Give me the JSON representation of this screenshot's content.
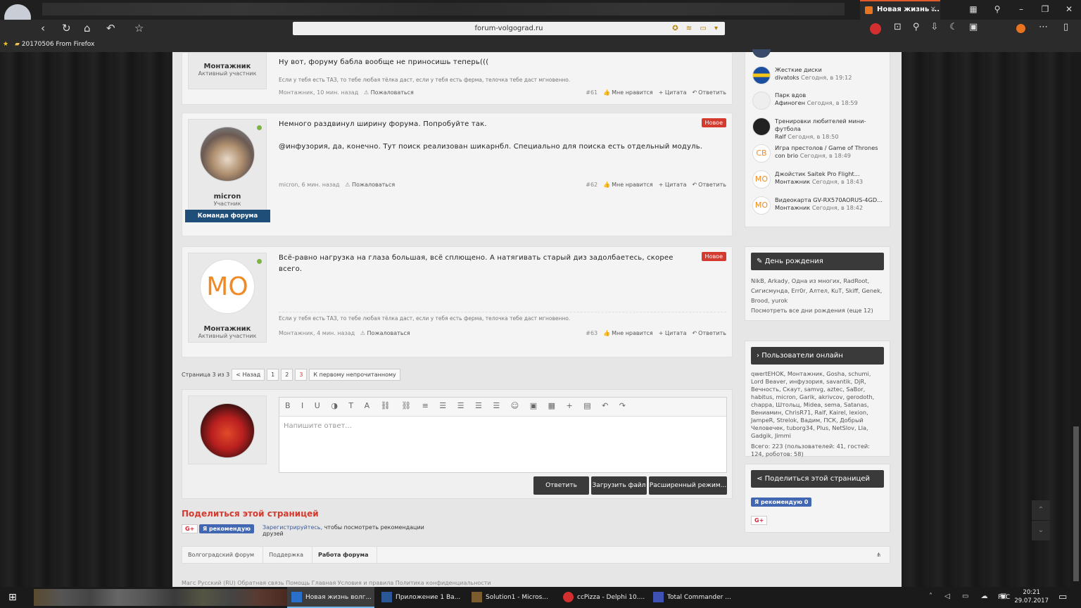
{
  "browser": {
    "active_tab_title": "Новая жизнь ...",
    "url": "forum-volgograd.ru",
    "bookmark": "20170506 From Firefox",
    "nav_icons": [
      "back-icon",
      "reload-icon",
      "home-icon",
      "undo-icon",
      "star-icon"
    ]
  },
  "posts": [
    {
      "user": "Монтажник",
      "role": "Активный участник",
      "text": "Ну вот, форуму бабла вообще не приносишь теперь(((",
      "signature": "Если у тебя есть ТАЗ, то тебе любая тёлка даст, если у тебя есть ферма, телочка тебе даст мгновенно.",
      "meta_left": "Монтажник, 10 мин. назад",
      "report": "Пожаловаться",
      "number": "#61",
      "like": "Мне нравится",
      "quote": "+ Цитата",
      "reply": "Ответить"
    },
    {
      "user": "micron",
      "role": "Участник",
      "team_badge": "Команда форума",
      "new_badge": "Новое",
      "text1": "Немного раздвинул ширину форума. Попробуйте так.",
      "text2": "@инфузория, да, конечно. Тут поиск реализован шикарнбл. Специально для поиска есть отдельный модуль.",
      "meta_left": "micron, 6 мин. назад",
      "report": "Пожаловаться",
      "number": "#62",
      "like": "Мне нравится",
      "quote": "+ Цитата",
      "reply": "Ответить"
    },
    {
      "user": "Монтажник",
      "role": "Активный участник",
      "avatar_text": "МО",
      "new_badge": "Новое",
      "text": "Всё-равно нагрузка на глаза большая, всё сплющено. А натягивать старый диз задолбаетесь, скорее всего.",
      "signature": "Если у тебя есть ТАЗ, то тебе любая тёлка даст, если у тебя есть ферма, телочка тебе даст мгновенно.",
      "meta_left": "Монтажник, 4 мин. назад",
      "report": "Пожаловаться",
      "number": "#63",
      "like": "Мне нравится",
      "quote": "+ Цитата",
      "reply": "Ответить"
    }
  ],
  "pager": {
    "label": "Страница 3 из 3",
    "prev": "< Назад",
    "pages": [
      "1",
      "2",
      "3"
    ],
    "first_unread": "К первому непрочитанному"
  },
  "editor": {
    "placeholder": "Напишите ответ...",
    "reply": "Ответить",
    "upload": "Загрузить файл",
    "advanced": "Расширенный режим..."
  },
  "share": {
    "title": "Поделиться этой страницей",
    "gplus": "G+",
    "fb": "Я рекомендую",
    "register": "Зарегистрируйтесь,",
    "register_rest": "чтобы посмотреть рекомендации друзей"
  },
  "breadcrumb": [
    "Волгоградский форум",
    "Поддержка",
    "Работа форума"
  ],
  "footer": "Магс   Русский (RU)          Обратная связь   Помощь   Главная   Условия и правила   Политика конфиденциальности",
  "sidebar": {
    "threads": [
      {
        "title": "Жесткие диски",
        "author": "divatoks",
        "time": "Сегодня, в 19:12"
      },
      {
        "title": "Парк вдов",
        "author": "Афиноген",
        "time": "Сегодня, в 18:59"
      },
      {
        "title": "Тренировки любителей мини-футбола",
        "author": "Ralf",
        "time": "Сегодня, в 18:50"
      },
      {
        "title": "Игра престолов / Game of Thrones",
        "author": "con brio",
        "time": "Сегодня, в 18:49",
        "icon": "CB"
      },
      {
        "title": "Джойстик Saitek Pro Flight...",
        "author": "Монтажник",
        "time": "Сегодня, в 18:43",
        "icon": "МО"
      },
      {
        "title": "Видеокарта GV-RX570AORUS-4GD...",
        "author": "Монтажник",
        "time": "Сегодня, в 18:42",
        "icon": "МО"
      }
    ],
    "birthday": {
      "title": "День рождения",
      "names": "NikB, Arkady, Одна из многих, RadRoot, Сигисмунда, Err0r, Алтел, KuT, Skiff, Genek, Brood, yurok",
      "all": "Посмотреть все дни рождения (еще 12)"
    },
    "online": {
      "title": "Пользователи онлайн",
      "names": "qwertEHOK, Монтажник, Gosha, schumi, Lord Beaver, инфузория, savantik, DjR, Вечность, Скаут, samvg, aztec, SaBor, habitus, micron, Garik, akrivcov, gerodoth, chappa, Штольц, Midea, sema, Satanas, Вениамин, ChrisR71, Ralf, Kairel, lexion, JampeR, Strelok, Вадим, ПСК, Добрый Человечек, tuborg34, Plus, NetSlov, Lla, Gadgik, Jimmi",
      "total": "Всего: 223 (пользователей: 41, гостей: 124, роботов: 58)"
    },
    "sharebox": {
      "title": "Поделиться этой страницей",
      "fb": "Я рекомендую 0",
      "gplus": "G+"
    }
  },
  "taskbar": {
    "apps": [
      {
        "label": "Новая жизнь волг...",
        "color": "#2a6fc9"
      },
      {
        "label": "Приложение 1 Ва...",
        "color": "#2b5797"
      },
      {
        "label": "Solution1 - Micros...",
        "color": "#7a5c2e"
      },
      {
        "label": "ccPizza - Delphi 10....",
        "color": "#d32f2f"
      },
      {
        "label": "Total Commander ...",
        "color": "#3f51b5"
      }
    ],
    "lang": "РУС",
    "time": "20:21",
    "date": "29.07.2017"
  }
}
